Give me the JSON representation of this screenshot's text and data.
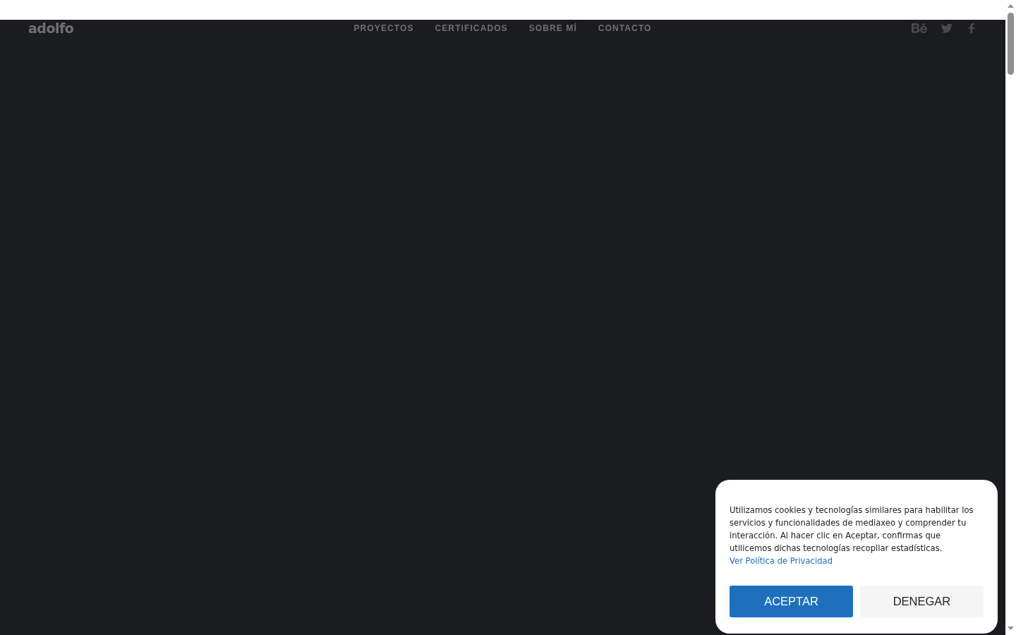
{
  "header": {
    "logo": "adolfo",
    "nav": [
      "PROYECTOS",
      "CERTIFICADOS",
      "SOBRE MÍ",
      "CONTACTO"
    ],
    "social": [
      {
        "kind": "behance"
      },
      {
        "kind": "twitter"
      },
      {
        "kind": "facebook"
      }
    ]
  },
  "cookie_banner": {
    "message": "Utilizamos cookies y tecnologías similares para habilitar los servicios y funcionalidades de mediaxeo y comprender tu interacción. Al hacer clic en Aceptar, confirmas que utilicemos dichas tecnologías recopilar estadísticas.",
    "link": "Ver Política de Privacidad",
    "buttons": [
      {
        "label": "ACEPTAR",
        "kind": "primary"
      },
      {
        "label": "DENEGAR",
        "kind": "secondary"
      }
    ]
  }
}
